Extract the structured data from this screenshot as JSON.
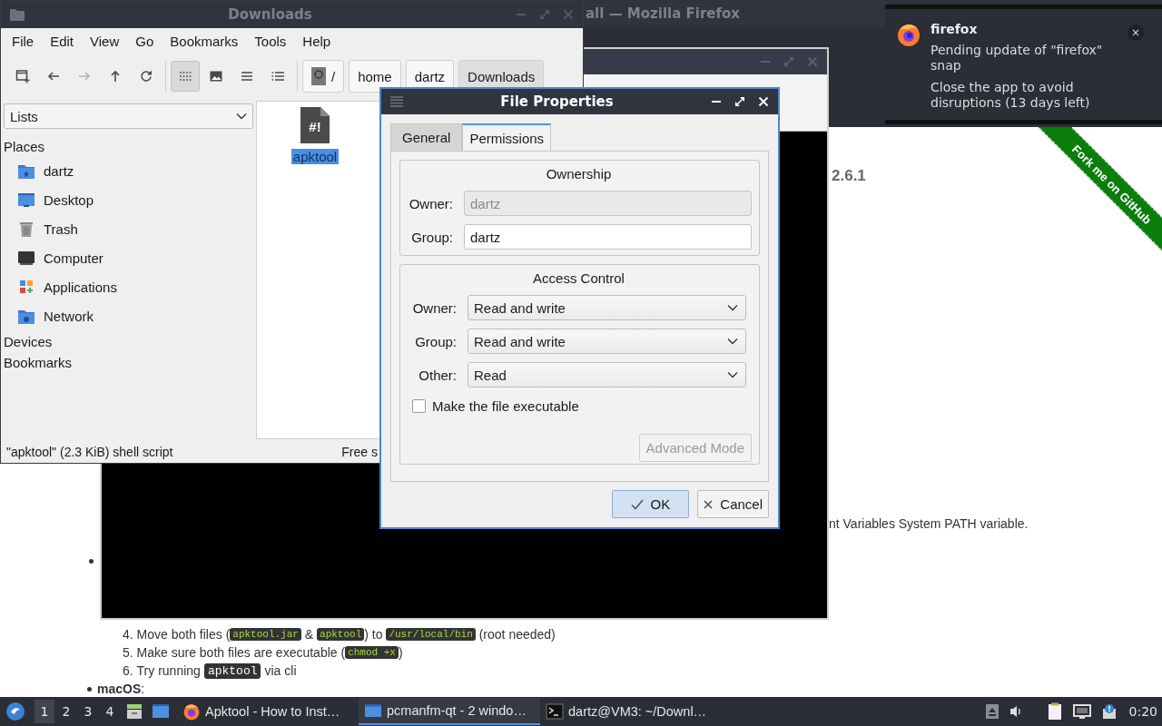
{
  "firefox_window": {
    "title": "all — Mozilla Firefox",
    "page": {
      "version": "2.6.1",
      "ribbon": "Fork me on GitHub",
      "fragment": "nt Variables System PATH variable.",
      "steps": [
        {
          "number": "4.",
          "parts": [
            {
              "kind": "text",
              "text": "Move both files ("
            },
            {
              "kind": "code",
              "text": "apktool.jar"
            },
            {
              "kind": "text",
              "text": " & "
            },
            {
              "kind": "code",
              "text": "apktool"
            },
            {
              "kind": "text",
              "text": ") to "
            },
            {
              "kind": "code",
              "text": "/usr/local/bin"
            },
            {
              "kind": "text",
              "text": " (root needed)"
            }
          ]
        },
        {
          "number": "5.",
          "parts": [
            {
              "kind": "text",
              "text": "Make sure both files are executable ("
            },
            {
              "kind": "code",
              "text": "chmod +x"
            },
            {
              "kind": "text",
              "text": ")"
            }
          ]
        },
        {
          "number": "6.",
          "parts": [
            {
              "kind": "text",
              "text": "Try running"
            },
            {
              "kind": "command",
              "text": "apktool"
            },
            {
              "kind": "text",
              "text": "via cli"
            }
          ]
        }
      ],
      "platform": "**macOS**:"
    }
  },
  "file_manager": {
    "title": "Downloads",
    "menu": [
      "File",
      "Edit",
      "View",
      "Go",
      "Bookmarks",
      "Tools",
      "Help"
    ],
    "toolbar": [
      {
        "kind": "new-window",
        "disabled": false
      },
      {
        "kind": "back",
        "disabled": false
      },
      {
        "kind": "forward",
        "disabled": true
      },
      {
        "kind": "up",
        "disabled": false
      },
      {
        "kind": "reload",
        "disabled": false
      }
    ],
    "view_modes": [
      {
        "kind": "icons",
        "selected": true
      },
      {
        "kind": "thumbnails",
        "selected": false
      },
      {
        "kind": "compact",
        "selected": false
      },
      {
        "kind": "details",
        "selected": false
      }
    ],
    "path": [
      {
        "label": "/",
        "selected": false
      },
      {
        "label": "home",
        "selected": false
      },
      {
        "label": "dartz",
        "selected": false
      },
      {
        "label": "Downloads",
        "selected": true
      }
    ],
    "sidebar": {
      "mode": "Lists",
      "sections": [
        {
          "label": "Places",
          "items": [
            {
              "label": "dartz",
              "kind": "home"
            },
            {
              "label": "Desktop",
              "kind": "desktop"
            },
            {
              "label": "Trash",
              "kind": "trash"
            },
            {
              "label": "Computer",
              "kind": "computer"
            },
            {
              "label": "Applications",
              "kind": "applications"
            },
            {
              "label": "Network",
              "kind": "network"
            }
          ]
        },
        {
          "label": "Devices"
        },
        {
          "label": "Bookmarks"
        }
      ]
    },
    "files": [
      {
        "name": "apktool",
        "badge": "#!",
        "selected": true
      }
    ],
    "status": {
      "left": "\"apktool\" (2.3 KiB) shell script",
      "right": "Free s"
    }
  },
  "properties_dialog": {
    "title": "File Properties",
    "tabs": [
      {
        "label": "General",
        "selected": false
      },
      {
        "label": "Permissions",
        "selected": true
      }
    ],
    "ownership": {
      "title": "Ownership",
      "fields": [
        {
          "label": "Owner:",
          "value": "dartz",
          "disabled": true
        },
        {
          "label": "Group:",
          "value": "dartz",
          "disabled": false
        }
      ]
    },
    "access": {
      "title": "Access Control",
      "selects": [
        {
          "label": "Owner:",
          "value": "Read and write"
        },
        {
          "label": "Group:",
          "value": "Read and write"
        },
        {
          "label": "Other:",
          "value": "Read"
        }
      ],
      "executable": {
        "label": "Make the file executable",
        "checked": false
      },
      "advanced": {
        "label": "Advanced Mode",
        "disabled": true
      }
    },
    "buttons": [
      {
        "label": "OK",
        "kind": "ok",
        "default": true
      },
      {
        "label": "Cancel",
        "kind": "cancel",
        "default": false
      }
    ]
  },
  "notification": {
    "app": "firefox",
    "lines": [
      "Pending update of \"firefox\" snap",
      "Close the app to avoid disruptions (13 days left)"
    ],
    "close": "×"
  },
  "taskbar": {
    "workspaces": [
      {
        "label": "1",
        "selected": true
      },
      {
        "label": "2",
        "selected": false
      },
      {
        "label": "3",
        "selected": false
      },
      {
        "label": "4",
        "selected": false
      }
    ],
    "tasks": [
      {
        "label": "Apktool - How to Inst…",
        "kind": "browser",
        "selected": false
      },
      {
        "label": "pcmanfm-qt - 2 windo…",
        "kind": "files",
        "selected": true
      },
      {
        "label": "dartz@VM3: ~/Downl…",
        "kind": "terminal",
        "selected": false
      }
    ],
    "clock": "0:20"
  }
}
